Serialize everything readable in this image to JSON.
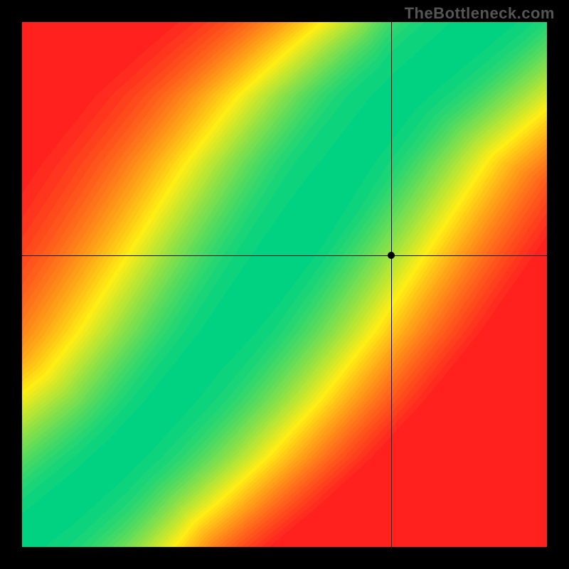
{
  "watermark": "TheBottleneck.com",
  "chart_data": {
    "type": "heatmap",
    "title": "",
    "xlabel": "",
    "ylabel": "",
    "xlim": [
      0,
      1
    ],
    "ylim": [
      0,
      1
    ],
    "grid": false,
    "legend": false,
    "colormap": "red-yellow-green",
    "crosshair": {
      "x": 0.703,
      "y": 0.556
    },
    "marker": {
      "x": 0.703,
      "y": 0.556
    },
    "ridge": {
      "description": "Green optimal band along a monotone curve from origin to near top-right, bending upward (steeper in the middle). Band about 0.05 wide. Values: 1.0 on ridge, falling to ~0.25 (orange) then 0 (red) away.",
      "control_points": [
        {
          "x": 0.0,
          "y": 0.0
        },
        {
          "x": 0.1,
          "y": 0.08
        },
        {
          "x": 0.2,
          "y": 0.17
        },
        {
          "x": 0.3,
          "y": 0.28
        },
        {
          "x": 0.4,
          "y": 0.41
        },
        {
          "x": 0.5,
          "y": 0.57
        },
        {
          "x": 0.6,
          "y": 0.73
        },
        {
          "x": 0.7,
          "y": 0.86
        },
        {
          "x": 0.8,
          "y": 0.95
        },
        {
          "x": 0.86,
          "y": 1.0
        }
      ],
      "band_half_width": 0.035,
      "falloff": 0.45
    }
  }
}
